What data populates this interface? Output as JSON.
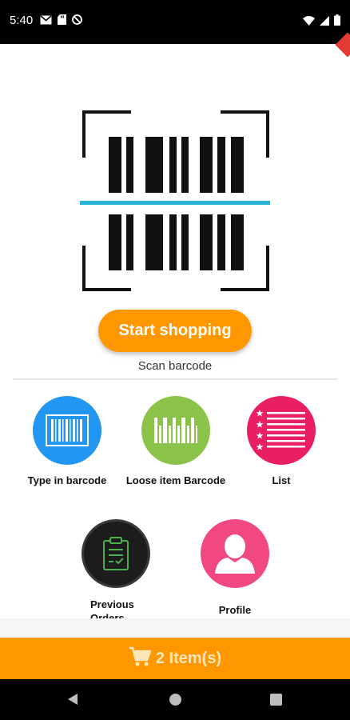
{
  "status_bar": {
    "time": "5:40",
    "left_icons": [
      "gmail-icon",
      "sd-card-icon",
      "do-not-disturb-icon"
    ],
    "right_icons": [
      "wifi-icon",
      "signal-icon",
      "battery-icon"
    ]
  },
  "scanner": {
    "icon": "barcode-scanner-icon",
    "scan_line_color": "#26b3d4"
  },
  "main": {
    "start_button_label": "Start shopping",
    "scan_caption": "Scan barcode"
  },
  "actions": [
    {
      "label": "Type in barcode",
      "icon": "barcode-icon",
      "color": "#2196f3"
    },
    {
      "label": "Loose item Barcode",
      "icon": "loose-barcode-icon",
      "color": "#8bc34a"
    },
    {
      "label": "List",
      "icon": "list-icon",
      "color": "#e91e63"
    },
    {
      "label": "Previous Orders",
      "icon": "clipboard-check-icon",
      "color": "#1c1c1c",
      "accent": "#4caf50"
    },
    {
      "label": "Profile",
      "icon": "person-icon",
      "color": "#f0487f"
    }
  ],
  "cart": {
    "icon": "cart-icon",
    "label": "2 Item(s)"
  },
  "nav": {
    "back_icon": "back-icon",
    "home_icon": "home-icon",
    "recents_icon": "recents-icon"
  },
  "colors": {
    "accent": "#ff9800",
    "status_bar": "#000000"
  }
}
